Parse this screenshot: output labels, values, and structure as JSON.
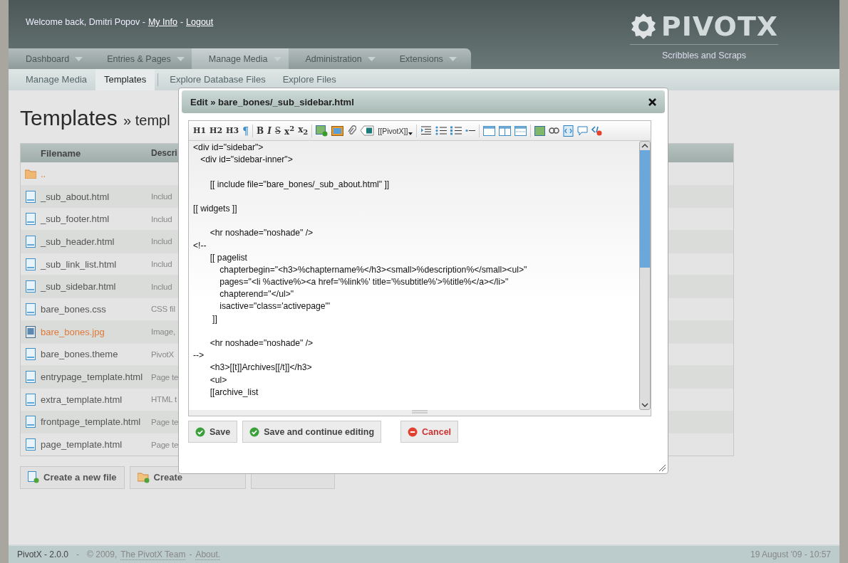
{
  "header": {
    "welcome": "Welcome back, Dmitri Popov -",
    "my_info": "My Info",
    "separator": "-",
    "logout": "Logout",
    "logo_text": "PIVOTX",
    "tagline": "Scribbles and Scraps"
  },
  "nav": [
    {
      "label": "Dashboard",
      "selected": false
    },
    {
      "label": "Entries & Pages",
      "selected": false
    },
    {
      "label": "Manage Media",
      "selected": true
    },
    {
      "label": "Administration",
      "selected": false
    },
    {
      "label": "Extensions",
      "selected": false
    }
  ],
  "subnav": [
    {
      "label": "Manage Media",
      "selected": false
    },
    {
      "label": "Templates",
      "selected": true
    },
    {
      "label": "Explore Database Files",
      "selected": false
    },
    {
      "label": "Explore Files",
      "selected": false
    }
  ],
  "page": {
    "title": "Templates",
    "crumb": "» templ"
  },
  "table": {
    "columns": [
      "Filename",
      "Descri"
    ],
    "rows": [
      {
        "kind": "folder",
        "name": ".."
      },
      {
        "kind": "file",
        "name": "_sub_about.html",
        "description": "Includ"
      },
      {
        "kind": "file",
        "name": "_sub_footer.html",
        "description": "Includ"
      },
      {
        "kind": "file",
        "name": "_sub_header.html",
        "description": "Includ"
      },
      {
        "kind": "file",
        "name": "_sub_link_list.html",
        "description": "Includ"
      },
      {
        "kind": "file",
        "name": "_sub_sidebar.html",
        "description": "Includ"
      },
      {
        "kind": "file",
        "name": "bare_bones.css",
        "description": "CSS fil"
      },
      {
        "kind": "image",
        "name": "bare_bones.jpg",
        "description": "Image,"
      },
      {
        "kind": "file",
        "name": "bare_bones.theme",
        "description": "PivotX"
      },
      {
        "kind": "file",
        "name": "entrypage_template.html",
        "description": "Page te"
      },
      {
        "kind": "file",
        "name": "extra_template.html",
        "description": "HTML t"
      },
      {
        "kind": "file",
        "name": "frontpage_template.html",
        "description": "Page te"
      },
      {
        "kind": "file",
        "name": "page_template.html",
        "description": "Page te"
      }
    ]
  },
  "actions": [
    {
      "kind": "file",
      "label": "Create a new file"
    },
    {
      "kind": "folder",
      "label": "Create"
    },
    {
      "kind": "blank"
    }
  ],
  "dialog": {
    "title": "Edit » bare_bones/_sub_sidebar.html",
    "toolbar_text": [
      "H1",
      "H2",
      "H3",
      "¶",
      "B",
      "I",
      "S",
      "x$^{2}$",
      "x$_{2}$",
      "[[PivotX]]"
    ],
    "code": [
      {
        "kind": "line",
        "text": "<div id=\"sidebar\">"
      },
      {
        "kind": "line",
        "text": "   <div id=\"sidebar-inner\">"
      },
      {
        "kind": "blank"
      },
      {
        "kind": "line",
        "text": "       [[ include file=\"bare_bones/_sub_about.html\" ]]"
      },
      {
        "kind": "blank"
      },
      {
        "kind": "line",
        "text": "[[ widgets ]]"
      },
      {
        "kind": "blank"
      },
      {
        "kind": "line",
        "text": "       <hr noshade=\"noshade\" />"
      },
      {
        "kind": "line",
        "text": "<!--"
      },
      {
        "kind": "line",
        "text": "       [[ pagelist"
      },
      {
        "kind": "line",
        "text": "           chapterbegin=\"<h3>%chaptername%</h3><small>%description%</small><ul>\""
      },
      {
        "kind": "line",
        "text": "           pages=\"<li %active%><a href='%link%' title='%subtitle%'>%title%</a></li>\""
      },
      {
        "kind": "line",
        "text": "           chapterend=\"</ul>\""
      },
      {
        "kind": "line",
        "text": "           isactive=\"class='activepage'\""
      },
      {
        "kind": "line",
        "text": "        ]]"
      },
      {
        "kind": "blank"
      },
      {
        "kind": "line",
        "text": "       <hr noshade=\"noshade\" />"
      },
      {
        "kind": "line",
        "text": "-->"
      },
      {
        "kind": "line",
        "text": "       <h3>[[t]]Archives[[/t]]</h3>"
      },
      {
        "kind": "line",
        "text": "       <ul>"
      },
      {
        "kind": "line",
        "text": "       [[archive_list"
      }
    ],
    "buttons": [
      {
        "kind": "ok",
        "label": "Save"
      },
      {
        "kind": "ok",
        "label": "Save and continue editing"
      },
      {
        "kind": "cancel",
        "label": "Cancel"
      }
    ]
  },
  "footer": {
    "version": "PivotX - 2.0.0",
    "dash": "-",
    "copyright": "© 2009,",
    "team": "The PivotX Team",
    "sep": "-",
    "about": "About.",
    "date": "19 August '09 - 10:57"
  }
}
